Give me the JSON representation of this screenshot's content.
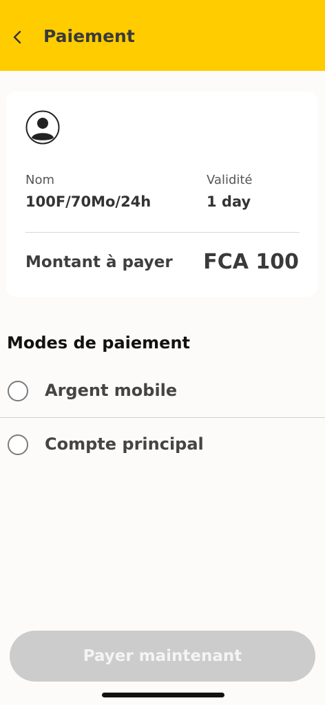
{
  "header": {
    "title": "Paiement",
    "back_icon": "chevron-left-icon",
    "background": "#ffcc00"
  },
  "summary": {
    "avatar_icon": "user-avatar-icon",
    "name_label": "Nom",
    "name_value": "100F/70Mo/24h",
    "validity_label": "Validité",
    "validity_value": "1 day",
    "amount_label": "Montant à payer",
    "amount_value": "FCA 100"
  },
  "payment_modes": {
    "title": "Modes de paiement",
    "options": [
      {
        "label": "Argent mobile",
        "selected": false
      },
      {
        "label": "Compte principal",
        "selected": false
      }
    ]
  },
  "footer": {
    "pay_button_label": "Payer maintenant",
    "pay_button_enabled": false
  }
}
